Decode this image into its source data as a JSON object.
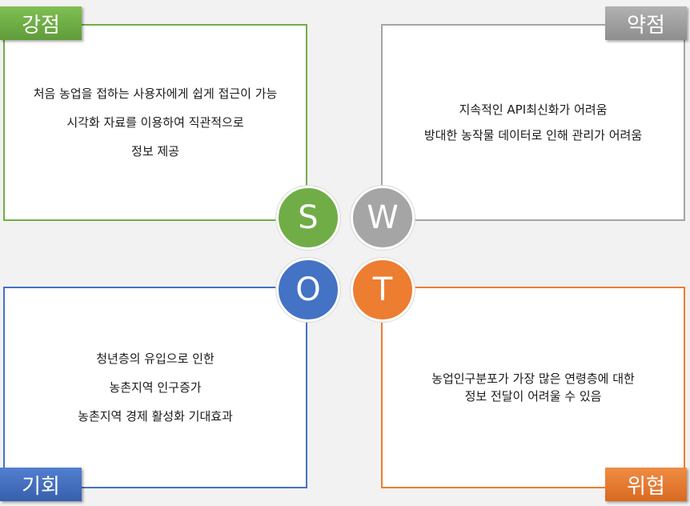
{
  "strengths": {
    "label": "강점",
    "letter": "S",
    "lines": [
      "처음 농업을 접하는 사용자에게  쉽게 접근이 가능",
      "시각화 자료를 이용하여 직관적으로",
      "정보 제공"
    ]
  },
  "weaknesses": {
    "label": "약점",
    "letter": "W",
    "lines": [
      "지속적인 API최신화가 어려움",
      "방대한 농작물 데이터로 인해 관리가 어려움"
    ]
  },
  "opportunities": {
    "label": "기회",
    "letter": "O",
    "lines": [
      "청년층의 유입으로 인한",
      "농촌지역 인구증가",
      "농촌지역 경제 활성화 기대효과"
    ]
  },
  "threats": {
    "label": "위협",
    "letter": "T",
    "lines": [
      "농업인구분포가 가장 많은 연령층에 대한",
      "정보 전달이 어려울 수 있음"
    ]
  },
  "colors": {
    "strengths": "#70ad47",
    "weaknesses": "#a5a5a5",
    "opportunities": "#4472c4",
    "threats": "#ed7d31"
  }
}
